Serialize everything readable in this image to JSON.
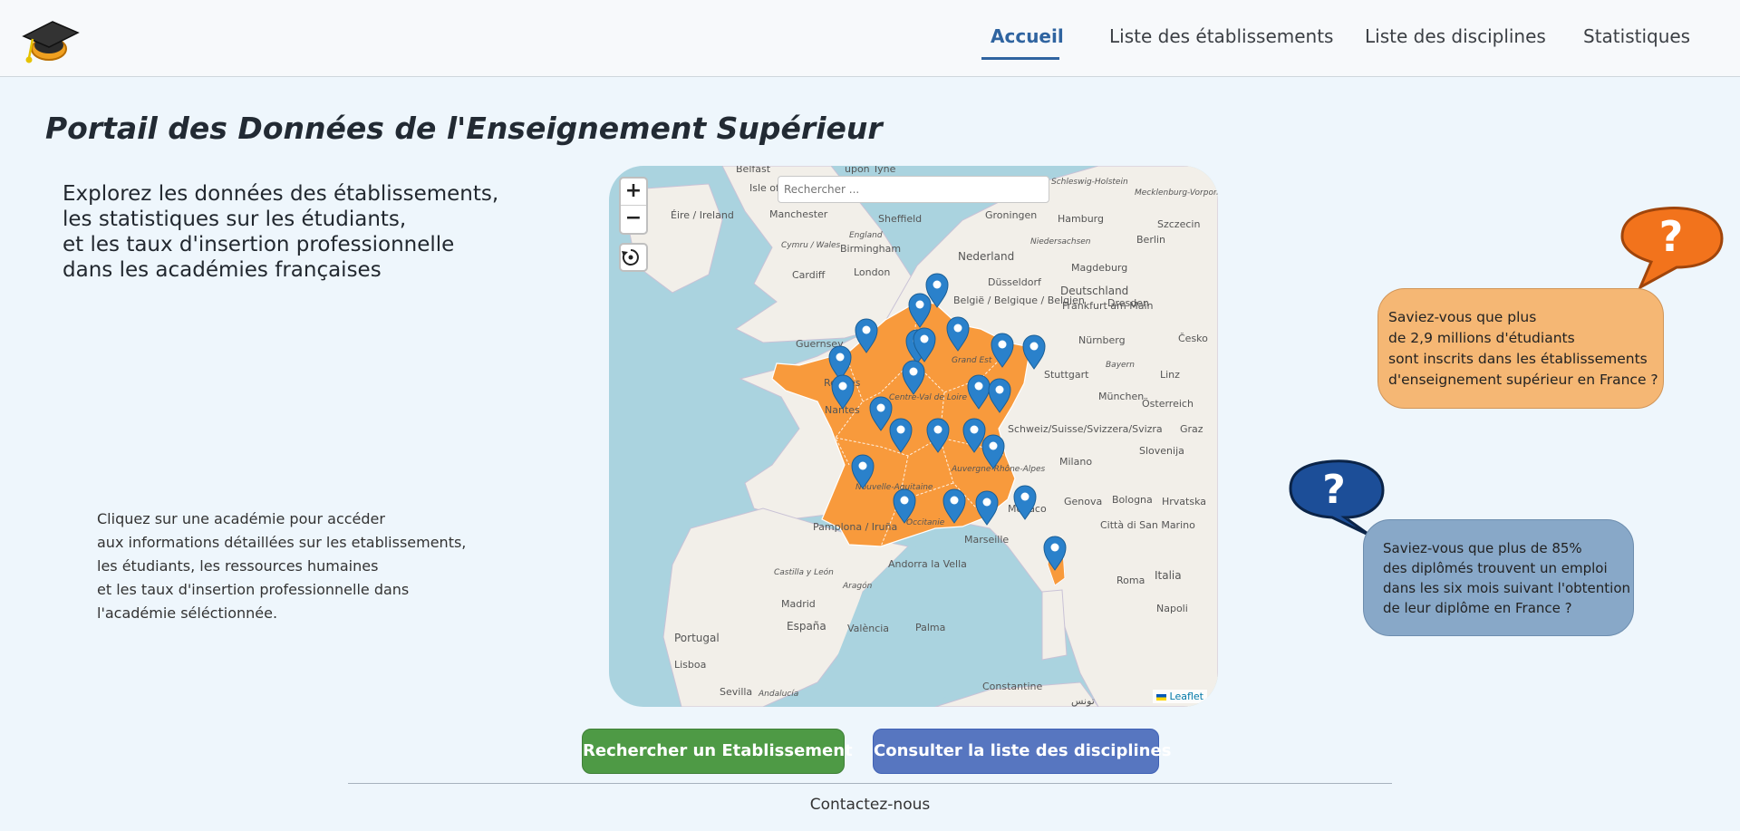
{
  "navbar": {
    "links": [
      {
        "label": "Accueil",
        "active": true
      },
      {
        "label": "Liste des établissements",
        "active": false
      },
      {
        "label": "Liste des disciplines",
        "active": false
      },
      {
        "label": "Statistiques",
        "active": false
      }
    ]
  },
  "page": {
    "title": "Portail des Données de l'Enseignement Supérieur",
    "intro": [
      "Explorez les données des établissements,",
      "les statistiques sur les étudiants,",
      "et les taux d'insertion professionnelle",
      "dans les académies françaises"
    ],
    "hint": [
      "Cliquez sur une académie pour accéder",
      "aux informations détaillées sur les etablissements,",
      "les étudiants, les ressources humaines",
      "et les taux d'insertion professionnelle dans",
      "l'académie séléctionnée."
    ]
  },
  "map": {
    "zoom_in": "+",
    "zoom_out": "−",
    "reset_icon": "reset-view-icon",
    "search_placeholder": "Rechercher ...",
    "attribution": "Leaflet",
    "france_color": "#f89a3c",
    "sea_color": "#aad3df",
    "land_color": "#f2efe9",
    "marker_color": "#2a81cb",
    "place_labels": [
      "Belfast",
      "upon Tyne",
      "Isle of Man",
      "Éire / Ireland",
      "Manchester",
      "Sheffield",
      "England",
      "Birmingham",
      "Cymru / Wales",
      "Cardiff",
      "London",
      "Groningen",
      "Nederland",
      "Hamburg",
      "Szczecin",
      "Berlin",
      "Niedersachsen",
      "Schleswig-Holstein",
      "Mecklenburg-Vorpommern",
      "Düsseldorf",
      "Magdeburg",
      "Deutschland",
      "België / Belgique / Belgien",
      "Frankfurt am Main",
      "Dresden",
      "Česko",
      "Nürnberg",
      "Bayern",
      "Stuttgart",
      "Linz",
      "München",
      "Guernsey",
      "Rennes",
      "Nantes",
      "Centre-Val de Loire",
      "Schweiz/Suisse/Svizzera/Svizra",
      "Österreich",
      "Graz",
      "Slovenija",
      "Milano",
      "Nouvelle-Aquitaine",
      "Auvergne-Rhône-Alpes",
      "Genova",
      "Bologna",
      "Hrvatska",
      "Città di San Marino",
      "Pamplona / Iruña",
      "Andorra la Vella",
      "Occitanie",
      "Marseille",
      "Monaco",
      "Roma",
      "Italia",
      "Napoli",
      "Castilla y León",
      "Aragón",
      "Madrid",
      "España",
      "València",
      "Palma",
      "Portugal",
      "Lisboa",
      "Sevilla",
      "Andalucía",
      "Constantine",
      "تونس",
      "Grand Est"
    ]
  },
  "bubbles": [
    {
      "lines": [
        "Saviez-vous que plus",
        "de 2,9 millions d'étudiants",
        "sont inscrits dans les établissements",
        "d'enseignement supérieur en France ?"
      ],
      "color": "#f5b774",
      "icon": "orange-question-bubble-icon"
    },
    {
      "lines": [
        "Saviez-vous que plus de 85%",
        "des diplômés trouvent un emploi",
        "dans les six mois suivant l'obtention",
        "de leur diplôme en France ?"
      ],
      "color": "#88a8c8",
      "icon": "blue-question-bubble-icon"
    }
  ],
  "buttons": {
    "search_establishment": "Rechercher un Etablissement",
    "disciplines_list": "Consulter la liste des disciplines"
  },
  "footer": {
    "contact": "Contactez-nous"
  },
  "logo": "graduation-cap-icon"
}
